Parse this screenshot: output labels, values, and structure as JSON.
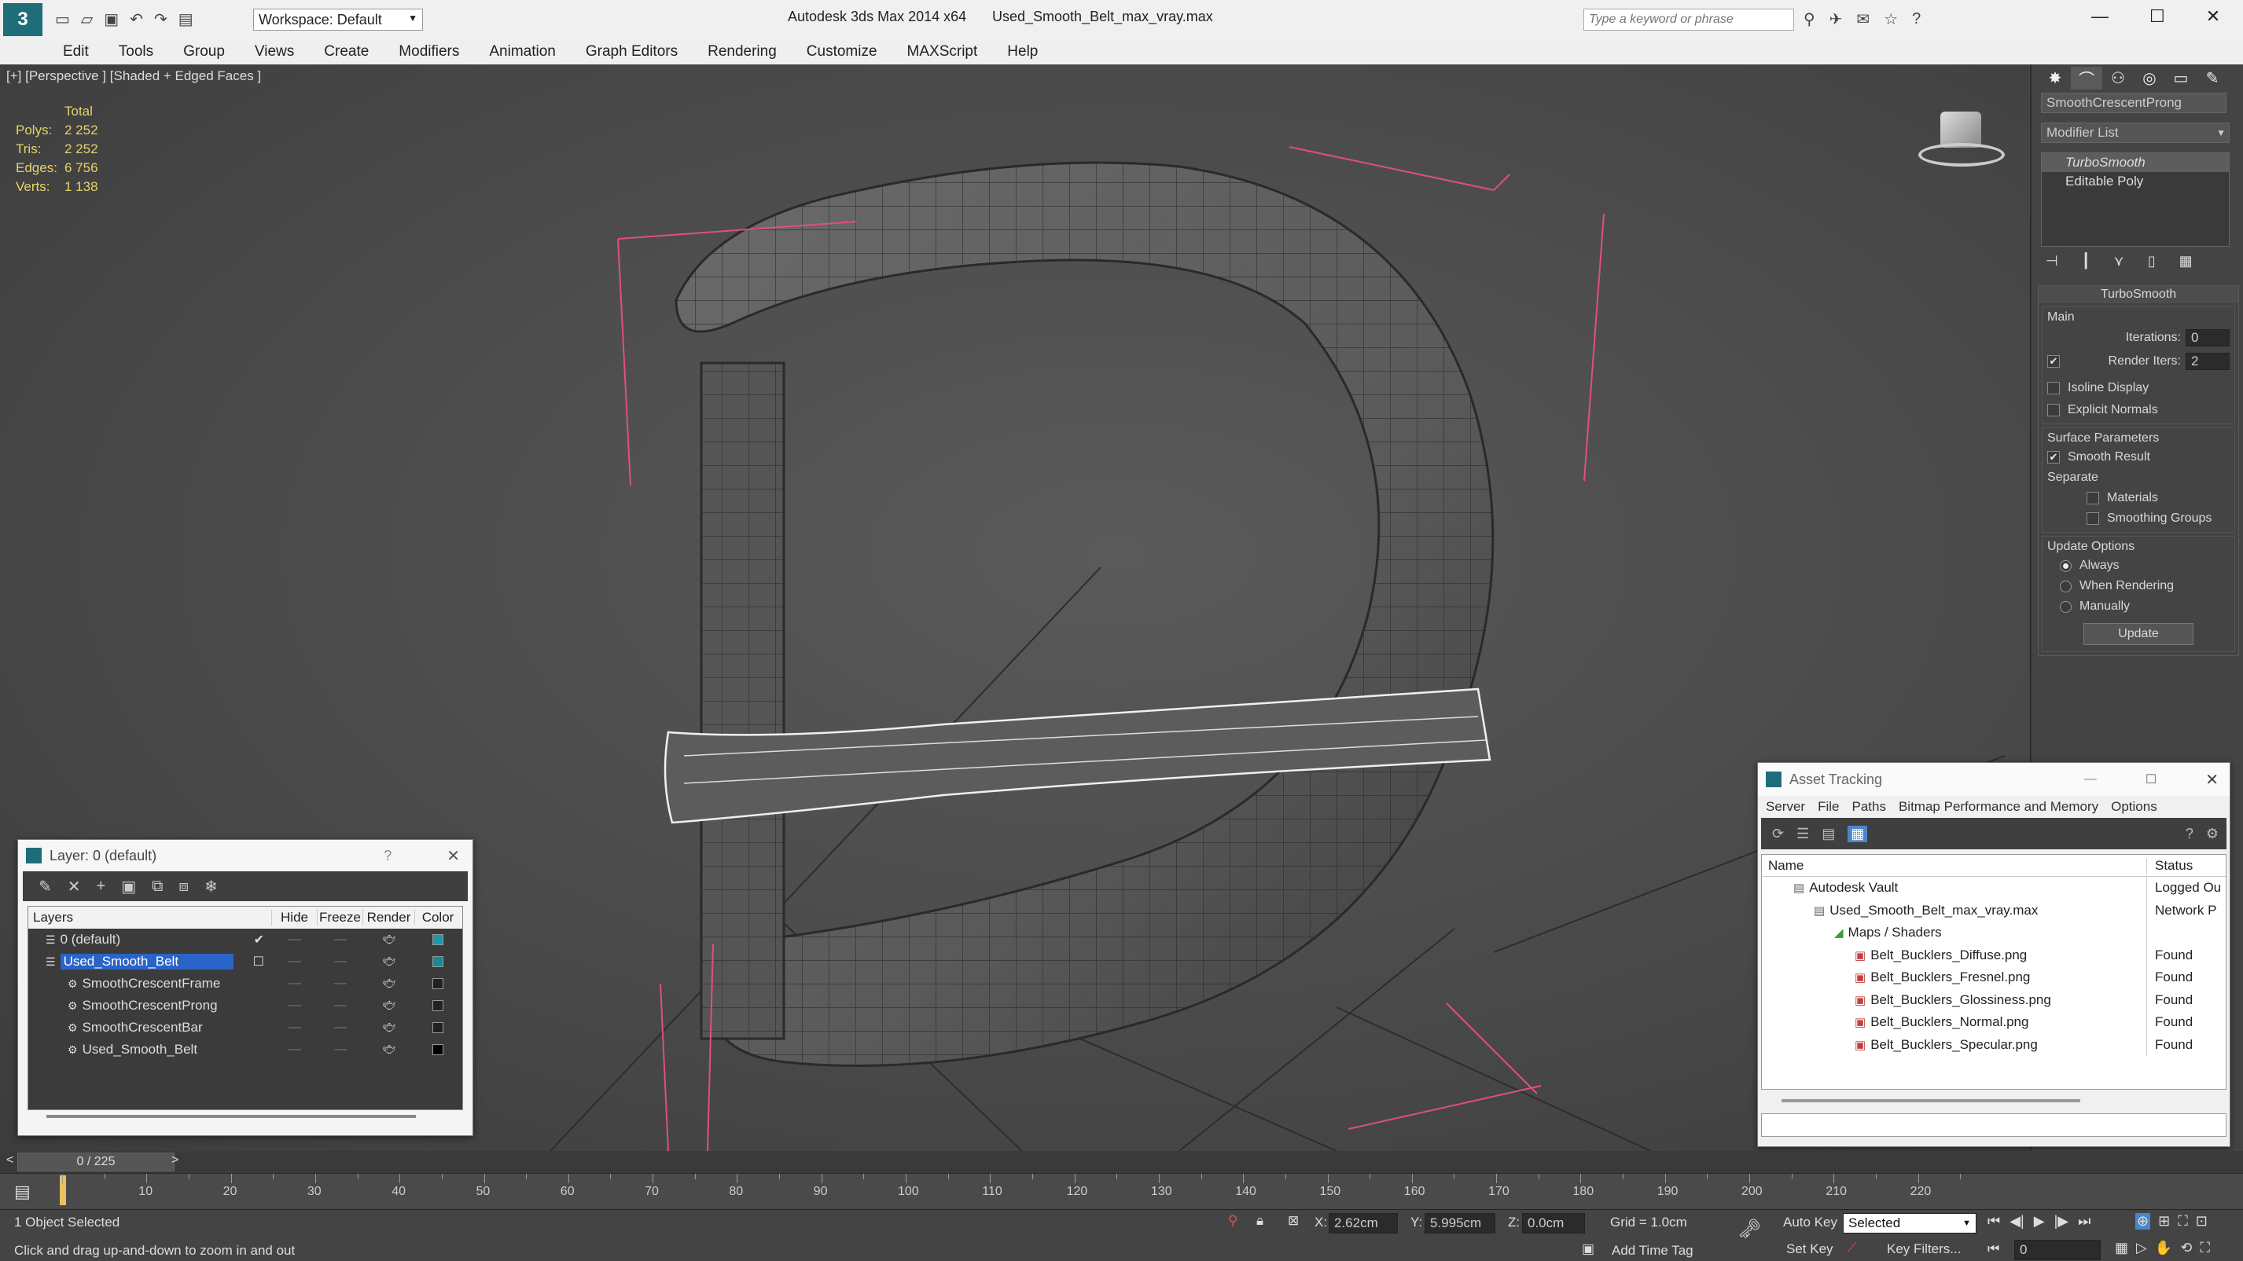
{
  "app": {
    "title": "Autodesk 3ds Max  2014 x64",
    "filename": "Used_Smooth_Belt_max_vray.max",
    "workspace": "Workspace: Default",
    "search_placeholder": "Type a keyword or phrase"
  },
  "menu": [
    "Edit",
    "Tools",
    "Group",
    "Views",
    "Create",
    "Modifiers",
    "Animation",
    "Graph Editors",
    "Rendering",
    "Customize",
    "MAXScript",
    "Help"
  ],
  "viewport": {
    "label": "[+] [Perspective ] [Shaded + Edged Faces ]",
    "stats": {
      "header": "Total",
      "rows": [
        {
          "k": "Polys:",
          "v": "2 252"
        },
        {
          "k": "Tris:",
          "v": "2 252"
        },
        {
          "k": "Edges:",
          "v": "6 756"
        },
        {
          "k": "Verts:",
          "v": "1 138"
        }
      ]
    }
  },
  "command_panel": {
    "object_name": "SmoothCrescentProng",
    "modifier_list": "Modifier List",
    "stack": [
      "TurboSmooth",
      "Editable Poly"
    ],
    "rollout_title": "TurboSmooth",
    "main_label": "Main",
    "iterations_label": "Iterations:",
    "iterations": "0",
    "render_iters_label": "Render Iters:",
    "render_iters": "2",
    "isoline": "Isoline Display",
    "explicit_normals": "Explicit Normals",
    "surface_params": "Surface Parameters",
    "smooth_result": "Smooth Result",
    "separate": "Separate",
    "materials": "Materials",
    "smoothing_groups": "Smoothing Groups",
    "update_options": "Update Options",
    "always": "Always",
    "when_rendering": "When Rendering",
    "manually": "Manually",
    "update_btn": "Update"
  },
  "layer_dialog": {
    "title": "Layer: 0 (default)",
    "help": "?",
    "columns": [
      "Layers",
      "Hide",
      "Freeze",
      "Render",
      "Color"
    ],
    "rows": [
      {
        "name": "0 (default)",
        "indent": 1,
        "color": "#1a9aa8",
        "check": true
      },
      {
        "name": "Used_Smooth_Belt",
        "indent": 1,
        "color": "#1a8a9a",
        "selected": true
      },
      {
        "name": "SmoothCrescentFrame",
        "indent": 2,
        "color": "#222222"
      },
      {
        "name": "SmoothCrescentProng",
        "indent": 2,
        "color": "#222222"
      },
      {
        "name": "SmoothCrescentBar",
        "indent": 2,
        "color": "#222222"
      },
      {
        "name": "Used_Smooth_Belt",
        "indent": 2,
        "color": "#000000"
      }
    ]
  },
  "asset_dialog": {
    "title": "Asset Tracking",
    "menu": [
      "Server",
      "File",
      "Paths",
      "Bitmap Performance and Memory",
      "Options"
    ],
    "columns": [
      "Name",
      "Status"
    ],
    "rows": [
      {
        "name": "Autodesk Vault",
        "status": "Logged Ou",
        "indent": 0
      },
      {
        "name": "Used_Smooth_Belt_max_vray.max",
        "status": "Network P",
        "indent": 1
      },
      {
        "name": "Maps / Shaders",
        "status": "",
        "indent": 2
      },
      {
        "name": "Belt_Bucklers_Diffuse.png",
        "status": "Found",
        "indent": 3
      },
      {
        "name": "Belt_Bucklers_Fresnel.png",
        "status": "Found",
        "indent": 3
      },
      {
        "name": "Belt_Bucklers_Glossiness.png",
        "status": "Found",
        "indent": 3
      },
      {
        "name": "Belt_Bucklers_Normal.png",
        "status": "Found",
        "indent": 3
      },
      {
        "name": "Belt_Bucklers_Specular.png",
        "status": "Found",
        "indent": 3
      }
    ]
  },
  "timeline": {
    "frame": "0 / 225",
    "ticks": [
      "10",
      "20",
      "30",
      "40",
      "50",
      "60",
      "70",
      "80",
      "90",
      "100",
      "110",
      "120",
      "130",
      "140",
      "150",
      "160",
      "170",
      "180",
      "190",
      "200",
      "210",
      "220"
    ]
  },
  "status": {
    "selected": "1 Object Selected",
    "hint": "Click and drag up-and-down to zoom in and out",
    "x_label": "X:",
    "x": "2.62cm",
    "y_label": "Y:",
    "y": "5.995cm",
    "z_label": "Z:",
    "z": "0.0cm",
    "grid": "Grid = 1.0cm",
    "auto_key": "Auto Key",
    "set_key": "Set Key",
    "selected_dd": "Selected",
    "key_filters": "Key Filters...",
    "add_time_tag": "Add Time Tag",
    "frame_field": "0"
  }
}
